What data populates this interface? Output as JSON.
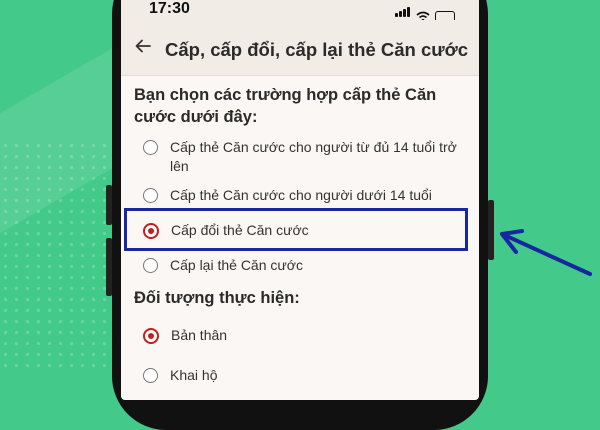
{
  "status_bar": {
    "time": "17:30"
  },
  "header": {
    "title": "Cấp, cấp đổi, cấp lại thẻ Căn cước",
    "back_icon": "arrow-left-icon"
  },
  "question": "Bạn chọn các trường hợp cấp thẻ Căn cước dưới đây:",
  "options": [
    {
      "label": "Cấp thẻ Căn cước cho người từ đủ 14 tuổi trở lên",
      "selected": false
    },
    {
      "label": "Cấp thẻ Căn cước cho người dưới 14 tuổi",
      "selected": false
    },
    {
      "label": "Cấp đổi thẻ Căn cước",
      "selected": true
    },
    {
      "label": "Cấp lại thẻ Căn cước",
      "selected": false
    }
  ],
  "performer": {
    "label": "Đối tượng thực hiện:",
    "options": [
      {
        "label": "Bản thân",
        "selected": true
      },
      {
        "label": "Khai hộ",
        "selected": false
      }
    ]
  },
  "colors": {
    "background": "#43c98a",
    "radio_selected": "#c21f1f",
    "annotation": "#1627a0"
  }
}
